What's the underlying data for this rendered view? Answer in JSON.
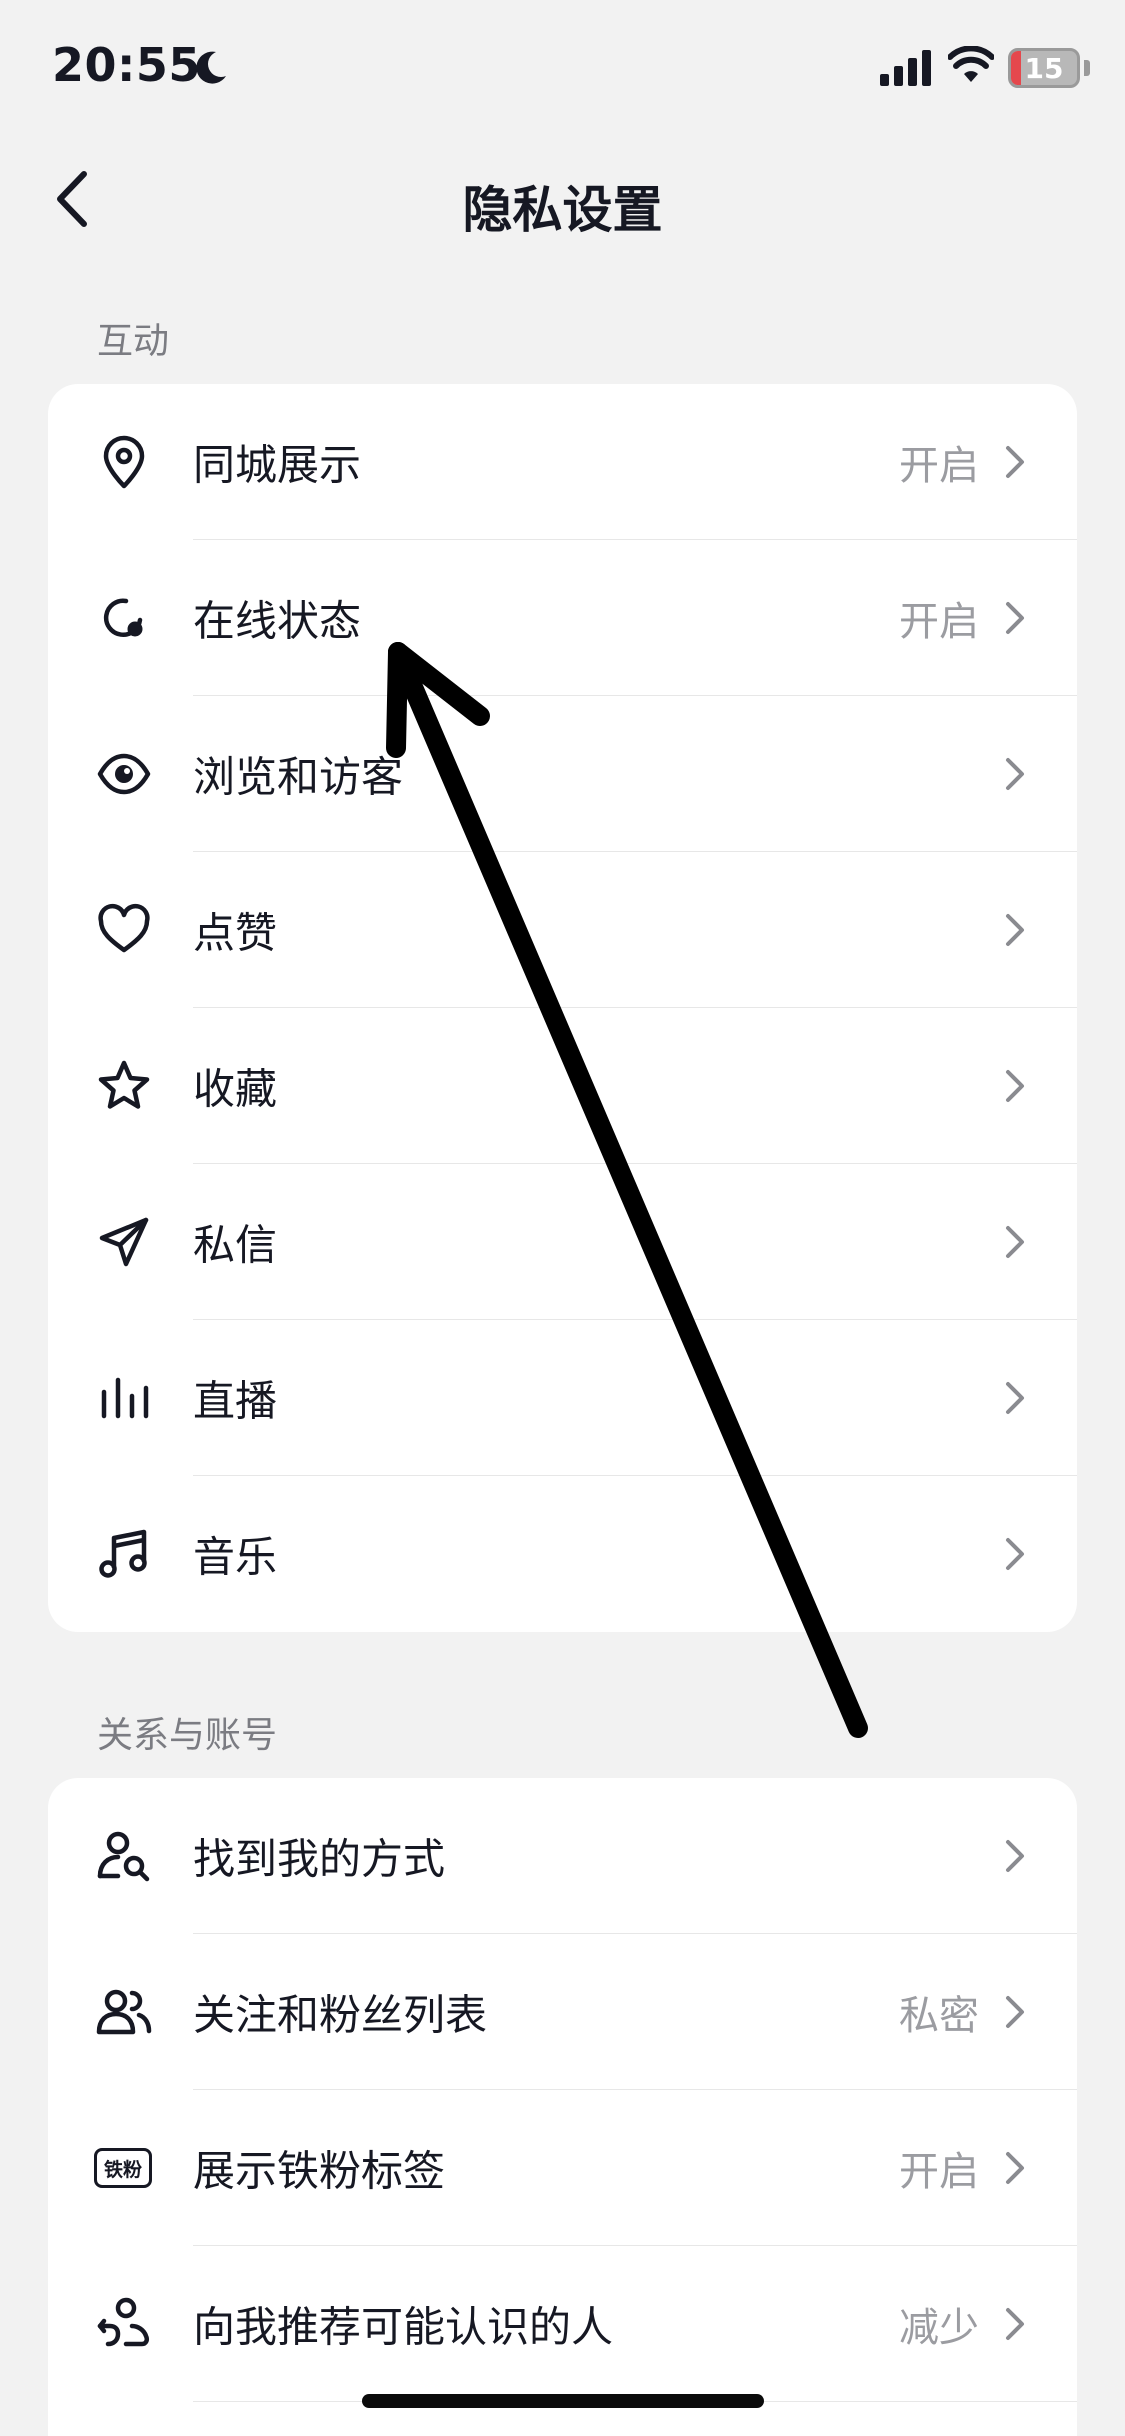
{
  "status_bar": {
    "time": "20:55",
    "battery_percent": "15",
    "battery_level": 0.15
  },
  "nav": {
    "title": "隐私设置"
  },
  "sections": [
    {
      "header": "互动",
      "items": [
        {
          "label": "同城展示",
          "value": "开启",
          "icon": "location-pin-icon"
        },
        {
          "label": "在线状态",
          "value": "开启",
          "icon": "online-status-icon"
        },
        {
          "label": "浏览和访客",
          "value": "",
          "icon": "eye-icon"
        },
        {
          "label": "点赞",
          "value": "",
          "icon": "heart-icon"
        },
        {
          "label": "收藏",
          "value": "",
          "icon": "star-icon"
        },
        {
          "label": "私信",
          "value": "",
          "icon": "paper-plane-icon"
        },
        {
          "label": "直播",
          "value": "",
          "icon": "live-bars-icon"
        },
        {
          "label": "音乐",
          "value": "",
          "icon": "music-note-icon"
        }
      ]
    },
    {
      "header": "关系与账号",
      "items": [
        {
          "label": "找到我的方式",
          "value": "",
          "icon": "user-search-icon"
        },
        {
          "label": "关注和粉丝列表",
          "value": "私密",
          "icon": "users-icon"
        },
        {
          "label": "展示铁粉标签",
          "value": "开启",
          "icon": "tiefen-badge-icon",
          "badge_text": "铁粉"
        },
        {
          "label": "向我推荐可能认识的人",
          "value": "减少",
          "icon": "recommend-people-icon"
        }
      ]
    }
  ],
  "colors": {
    "background": "#f2f2f2",
    "card": "#ffffff",
    "text": "#161823",
    "secondary": "#9b9ca1",
    "battery_red": "#e5484d"
  }
}
